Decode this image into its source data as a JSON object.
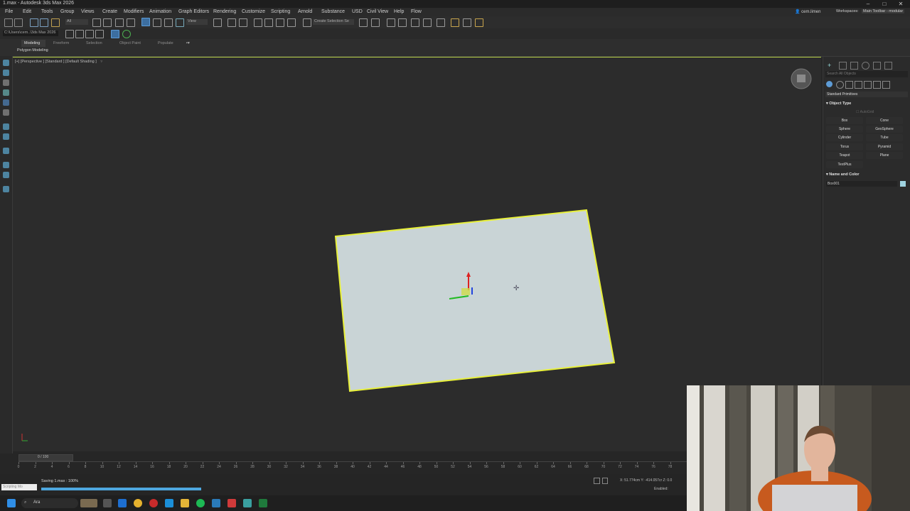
{
  "window": {
    "title": "1.max - Autodesk 3ds Max 2026",
    "controls": [
      "–",
      "□",
      "✕"
    ]
  },
  "menu": [
    "File",
    "Edit",
    "Tools",
    "Group",
    "Views",
    "Create",
    "Modifiers",
    "Animation",
    "Graph Editors",
    "Rendering",
    "Customize",
    "Scripting",
    "Arnold",
    "Substance",
    "USD",
    "Civil View",
    "Help",
    "Flow"
  ],
  "account": {
    "user": "cem.limen",
    "workspaces_label": "Workspaces:",
    "workspace_value": "Main Toolbar - modular"
  },
  "toolbar": {
    "selection_filter": "All",
    "reference_coord": "View",
    "named_selection": "Create Selection Se",
    "project_path": "C:\\Users\\cem..\\3ds Max 2026"
  },
  "ribbon": {
    "tabs": [
      "Modeling",
      "Freeform",
      "Selection",
      "Object Paint",
      "Populate"
    ],
    "active_tab": "Modeling",
    "subpanel": "Polygon Modeling"
  },
  "viewport": {
    "label": "[+] [Perspective ] [Standard ] [Default Shading ]",
    "filter_icon": "funnel-icon"
  },
  "command_panel": {
    "search_placeholder": "Search All Objects",
    "category": "Standard Primitives",
    "object_type_title": "Object Type",
    "autogrid": "AutoGrid",
    "primitives": [
      "Box",
      "Cone",
      "Sphere",
      "GeoSphere",
      "Cylinder",
      "Tube",
      "Torus",
      "Pyramid",
      "Teapot",
      "Plane",
      "TextPlus"
    ],
    "name_color_title": "Name and Color",
    "object_name": "Box001",
    "object_color": "#9fd3e0"
  },
  "timeline": {
    "frame_display": "0 / 100",
    "ticks": [
      0,
      2,
      4,
      6,
      8,
      10,
      12,
      14,
      16,
      18,
      20,
      22,
      24,
      26,
      28,
      30,
      32,
      34,
      36,
      38,
      40,
      42,
      44,
      46,
      48,
      50,
      52,
      54,
      56,
      58,
      60,
      62,
      64,
      66,
      68,
      70,
      72,
      74,
      76,
      78
    ]
  },
  "status": {
    "script_label": "Scripting Mo",
    "saving_text": "Saving 1.max : 100%",
    "progress": 1.0,
    "coords": "X: 51.774cm  Y: -414.057cr  Z: 0.0",
    "enabled": "Enabled:"
  },
  "taskbar": {
    "search_text": "Ara"
  },
  "colors": {
    "selection_highlight": "#e8f03a",
    "plane_fill": "#c9d4d6",
    "accent_blue": "#4ea7df"
  }
}
